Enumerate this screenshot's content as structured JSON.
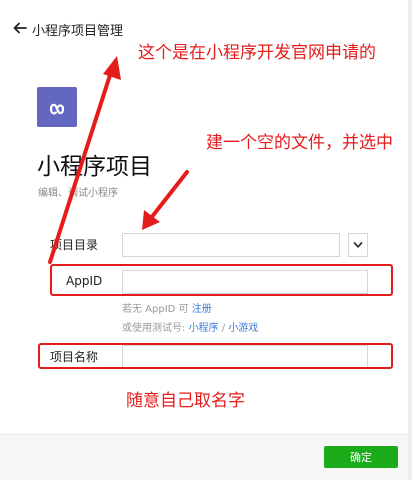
{
  "header": {
    "back_icon": "arrow-left-icon",
    "title": "小程序项目管理"
  },
  "logo": {
    "icon": "mini-program-logo-icon",
    "color": "#6467c0"
  },
  "page": {
    "title": "小程序项目",
    "subtitle": "编辑、调试小程序"
  },
  "form": {
    "project_dir_label": "项目目录",
    "project_dir_value": "",
    "appid_label": "AppID",
    "appid_value": "",
    "hint_prefix": "若无 AppID 可",
    "hint_register": "注册",
    "hint_test_prefix": "或使用测试号:",
    "hint_mini_program": "小程序",
    "hint_sep": "/",
    "hint_mini_game": "小游戏",
    "project_name_label": "项目名称",
    "project_name_value": ""
  },
  "annotations": {
    "note1": "这个是在小程序开发官网申请的",
    "note2": "建一个空的文件，并选中",
    "note3": "随意自己取名字",
    "color": "#e61b1b"
  },
  "footer": {
    "confirm_label": "确定",
    "confirm_color": "#1aad19"
  }
}
